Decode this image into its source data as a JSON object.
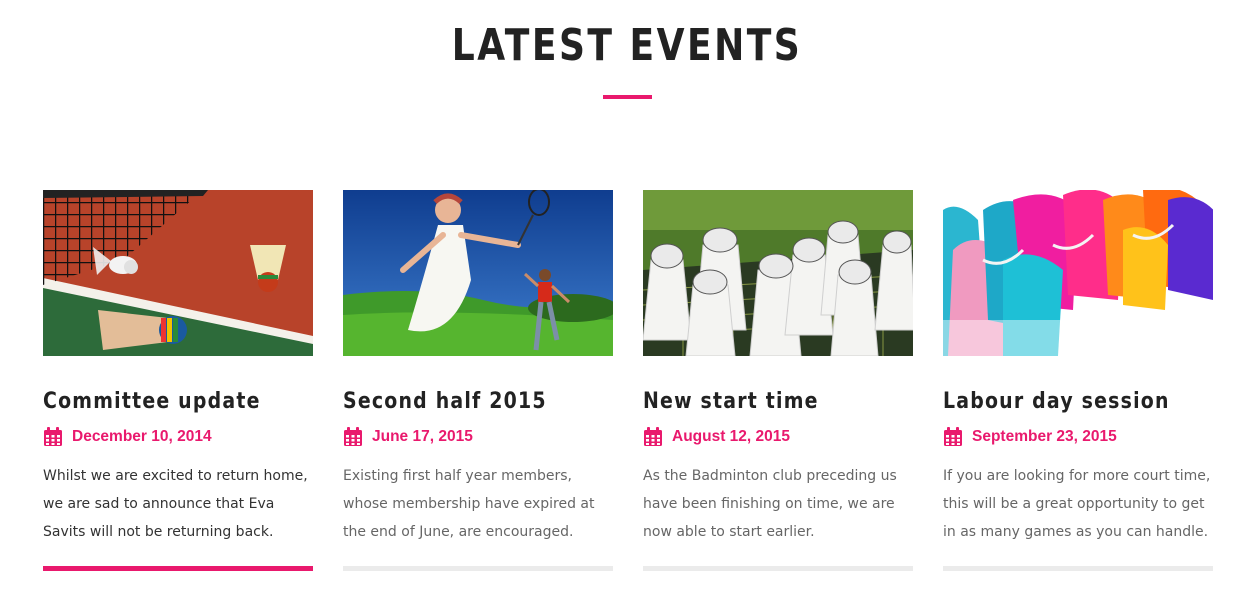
{
  "section": {
    "title": "LATEST EVENTS",
    "accent_color": "#e9196d"
  },
  "events": [
    {
      "title": "Committee update",
      "date": "December 10, 2014",
      "excerpt": "Whilst we are excited to return home, we are sad to announce that Eva Savits will not be returning back.",
      "image": "shuttlecocks-on-court-image",
      "active": true
    },
    {
      "title": "Second half 2015",
      "date": "June 17, 2015",
      "excerpt": "Existing first half year members, whose membership have expired at the end of June, are encouraged.",
      "image": "players-in-field-image",
      "active": false
    },
    {
      "title": "New start time",
      "date": "August 12, 2015",
      "excerpt": "As the Badminton club preceding us have been finishing on time, we are now able to start earlier.",
      "image": "shuttlecocks-on-racket-image",
      "active": false
    },
    {
      "title": "Labour day session",
      "date": "September 23, 2015",
      "excerpt": "If you are looking for more court time, this will be a great opportunity to get in as many games as you can handle.",
      "image": "colorful-feathers-image",
      "active": false
    }
  ],
  "icons": {
    "calendar": "calendar-icon"
  }
}
